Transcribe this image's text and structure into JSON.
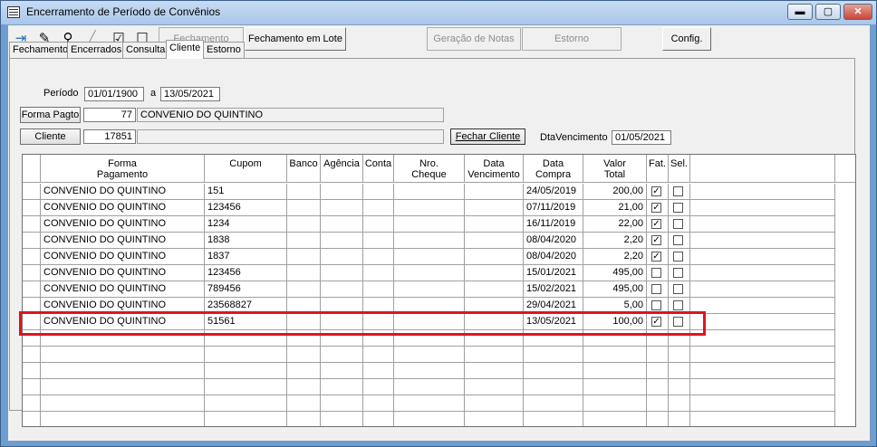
{
  "window": {
    "title": "Encerramento de Período de Convênios",
    "min_label": "▬",
    "max_label": "▢",
    "close_label": "✕"
  },
  "toolbar": {
    "fechamento": "Fechamento",
    "fechamento_lote": "Fechamento em Lote",
    "geracao_notas": "Geração de Notas",
    "estorno": "Estorno",
    "config": "Config."
  },
  "tabs": [
    "Fechamento",
    "Encerrados",
    "Consulta",
    "Cliente",
    "Estorno"
  ],
  "form": {
    "periodo_label": "Período",
    "periodo_de": "01/01/1900",
    "periodo_sep": "a",
    "periodo_ate": "13/05/2021",
    "forma_pagto_label": "Forma Pagto",
    "forma_pagto_code": "77",
    "forma_pagto_name": "CONVENIO DO QUINTINO",
    "cliente_label": "Cliente",
    "cliente_code": "17851",
    "cliente_name": "",
    "fechar_cliente_label": "Fechar Cliente",
    "dta_vencimento_label": "DtaVencimento",
    "dta_vencimento": "01/05/2021"
  },
  "grid": {
    "headers": [
      "Forma\nPagamento",
      "Cupom",
      "Banco",
      "Agência",
      "Conta",
      "Nro.\nCheque",
      "Data\nVencimento",
      "Data\nCompra",
      "Valor\nTotal",
      "Fat.",
      "Sel."
    ],
    "rows": [
      {
        "forma": "CONVENIO DO QUINTINO",
        "cupom": "151",
        "data_compra": "24/05/2019",
        "valor": "200,00",
        "fat": true,
        "sel": false
      },
      {
        "forma": "CONVENIO DO QUINTINO",
        "cupom": "123456",
        "data_compra": "07/11/2019",
        "valor": "21,00",
        "fat": true,
        "sel": false
      },
      {
        "forma": "CONVENIO DO QUINTINO",
        "cupom": "1234",
        "data_compra": "16/11/2019",
        "valor": "22,00",
        "fat": true,
        "sel": false
      },
      {
        "forma": "CONVENIO DO QUINTINO",
        "cupom": "1838",
        "data_compra": "08/04/2020",
        "valor": "2,20",
        "fat": true,
        "sel": false
      },
      {
        "forma": "CONVENIO DO QUINTINO",
        "cupom": "1837",
        "data_compra": "08/04/2020",
        "valor": "2,20",
        "fat": true,
        "sel": false
      },
      {
        "forma": "CONVENIO DO QUINTINO",
        "cupom": "123456",
        "data_compra": "15/01/2021",
        "valor": "495,00",
        "fat": false,
        "sel": false
      },
      {
        "forma": "CONVENIO DO QUINTINO",
        "cupom": "789456",
        "data_compra": "15/02/2021",
        "valor": "495,00",
        "fat": false,
        "sel": false
      },
      {
        "forma": "CONVENIO DO QUINTINO",
        "cupom": "23568827",
        "data_compra": "29/04/2021",
        "valor": "5,00",
        "fat": false,
        "sel": false
      },
      {
        "forma": "CONVENIO DO QUINTINO",
        "cupom": "51561",
        "data_compra": "13/05/2021",
        "valor": "100,00",
        "fat": true,
        "sel": false
      }
    ]
  },
  "colors": {
    "highlight": "#e0141e",
    "title_bar": "#a9c6ea"
  }
}
